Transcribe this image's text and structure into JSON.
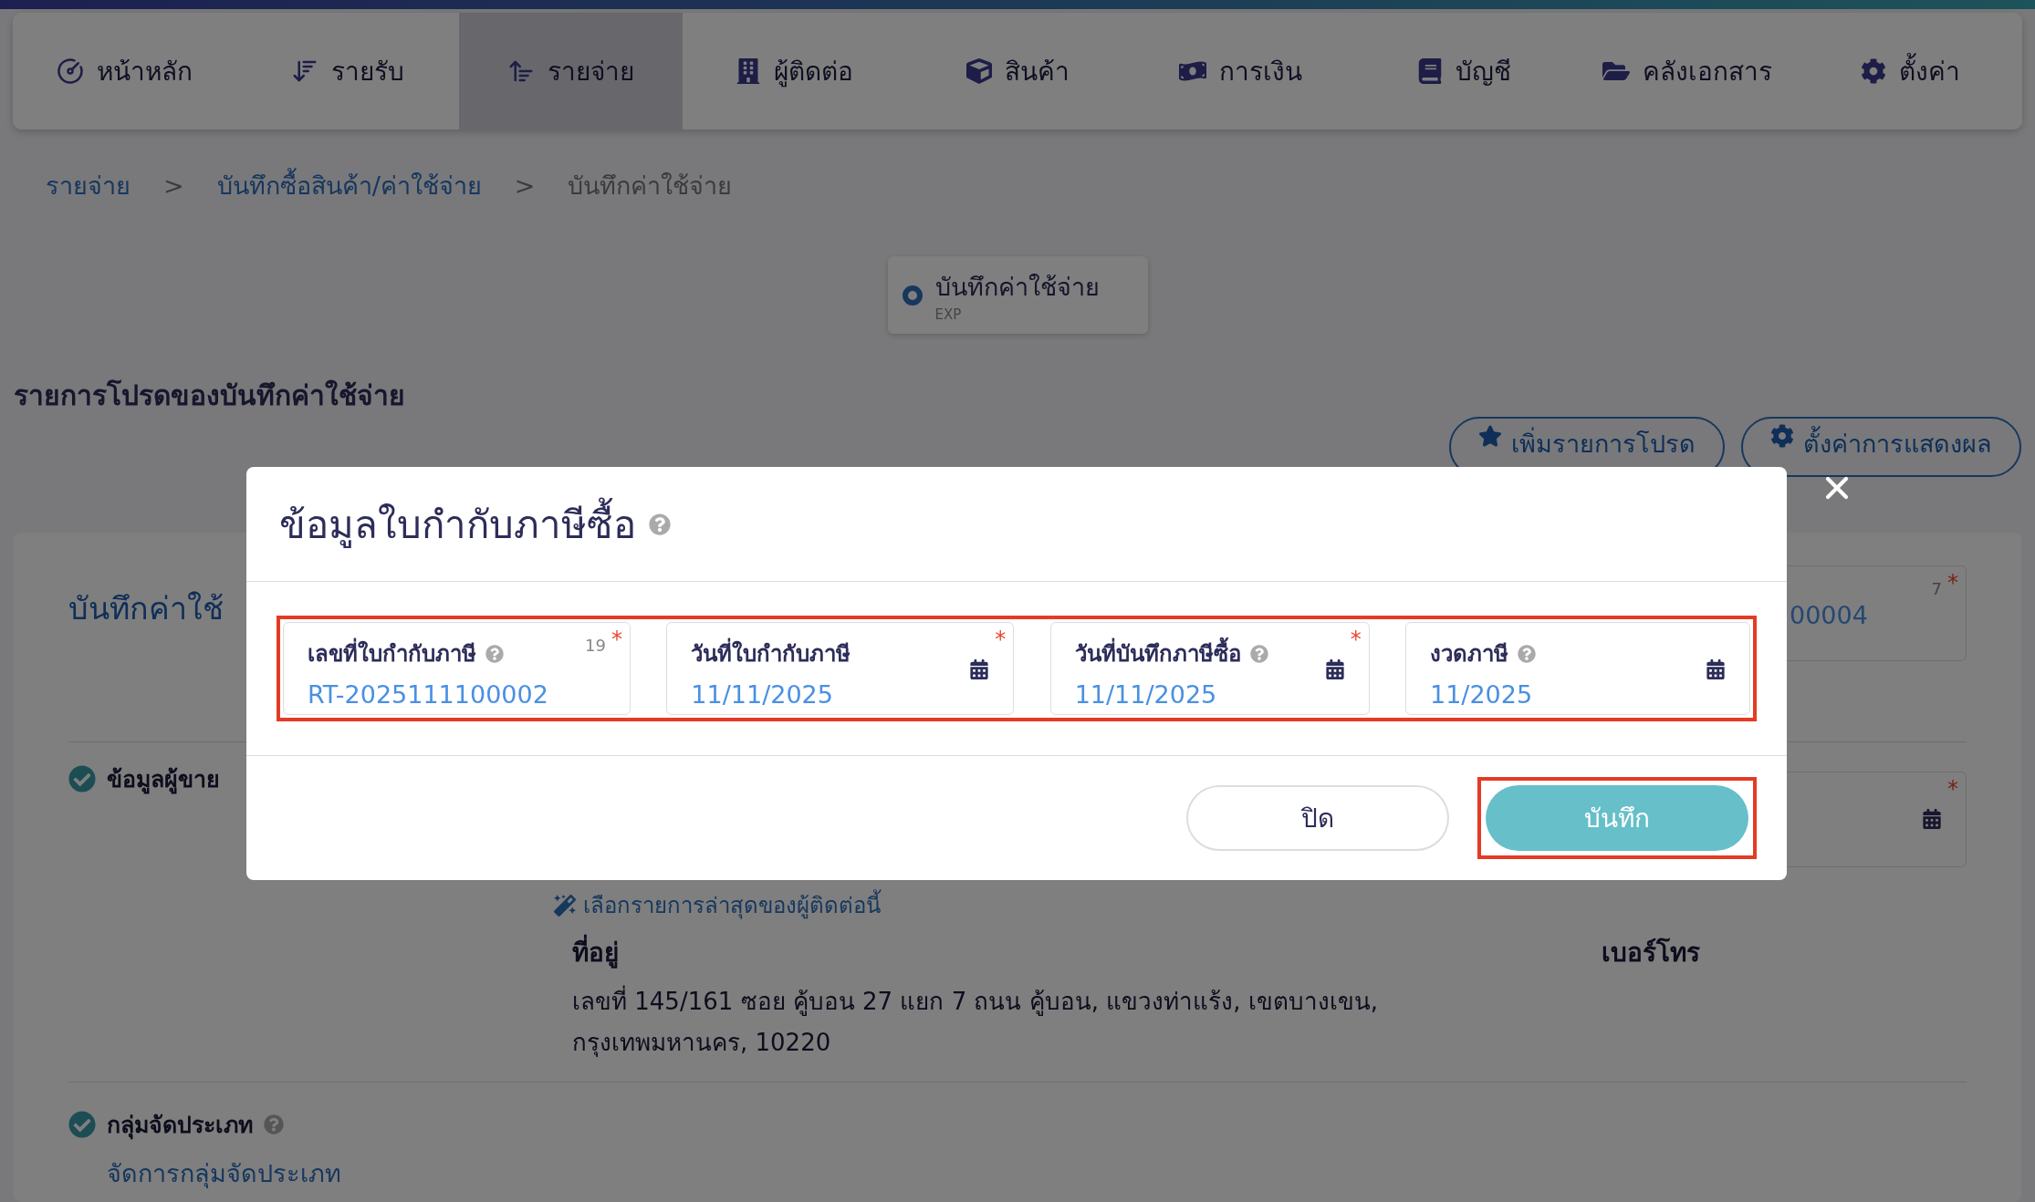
{
  "nav": {
    "items": [
      {
        "label": "หน้าหลัก",
        "selected": false
      },
      {
        "label": "รายรับ",
        "selected": false
      },
      {
        "label": "รายจ่าย",
        "selected": true
      },
      {
        "label": "ผู้ติดต่อ",
        "selected": false
      },
      {
        "label": "สินค้า",
        "selected": false
      },
      {
        "label": "การเงิน",
        "selected": false
      },
      {
        "label": "บัญชี",
        "selected": false
      },
      {
        "label": "คลังเอกสาร",
        "selected": false
      },
      {
        "label": "ตั้งค่า",
        "selected": false
      }
    ]
  },
  "breadcrumb": {
    "separator": ">",
    "items": [
      {
        "label": "รายจ่าย",
        "current": false
      },
      {
        "label": "บันทึกซื้อสินค้า/ค่าใช้จ่าย",
        "current": false
      },
      {
        "label": "บันทึกค่าใช้จ่าย",
        "current": true
      }
    ]
  },
  "doc_type": {
    "label": "บันทึกค่าใช้จ่าย",
    "code": "EXP",
    "selected": true
  },
  "favorites": {
    "title": "รายการโปรดของบันทึกค่าใช้จ่าย",
    "buttons": [
      "เพิ่มรายการโปรด",
      "ตั้งค่าการแสดงผล"
    ]
  },
  "form": {
    "required_mark": "*",
    "title": "บันทึกค่าใช้",
    "number_field": {
      "value": "00004",
      "counter": "7",
      "required": true
    },
    "vendor_section": {
      "title": "ข้อมูลผู้ขาย",
      "done": true,
      "date_field": {
        "required": true
      },
      "recent_link": "เลือกรายการล่าสุดของผู้ติดต่อนี้",
      "address_label": "ที่อยู่",
      "address": "เลขที่ 145/161 ซอย คู้บอน 27 แยก 7 ถนน คู้บอน, แขวงท่าแร้ง, เขตบางเขน, กรุงเทพมหานคร, 10220",
      "phone_label": "เบอร์โทร"
    },
    "category_section": {
      "title": "กลุ่มจัดประเภท",
      "done": true,
      "link": "จัดการกลุ่มจัดประเภท"
    }
  },
  "modal": {
    "required_mark": "*",
    "title": "ข้อมูลใบกำกับภาษีซื้อ",
    "fields_highlighted": true,
    "fields": [
      {
        "kind": "text",
        "label": "เลขที่ใบกำกับภาษี",
        "help": true,
        "counter": "19",
        "required": true,
        "value": "RT-2025111100002"
      },
      {
        "kind": "date",
        "label": "วันที่ใบกำกับภาษี",
        "help": false,
        "required": true,
        "value": "11/11/2025"
      },
      {
        "kind": "date",
        "label": "วันที่บันทึกภาษีซื้อ",
        "help": true,
        "required": true,
        "value": "11/11/2025"
      },
      {
        "kind": "date",
        "label": "งวดภาษี",
        "help": true,
        "required": false,
        "value": "11/2025"
      }
    ],
    "buttons": [
      {
        "kind": "secondary",
        "label": "ปิด",
        "highlighted": false
      },
      {
        "kind": "primary",
        "label": "บันทึก",
        "highlighted": true
      }
    ]
  }
}
